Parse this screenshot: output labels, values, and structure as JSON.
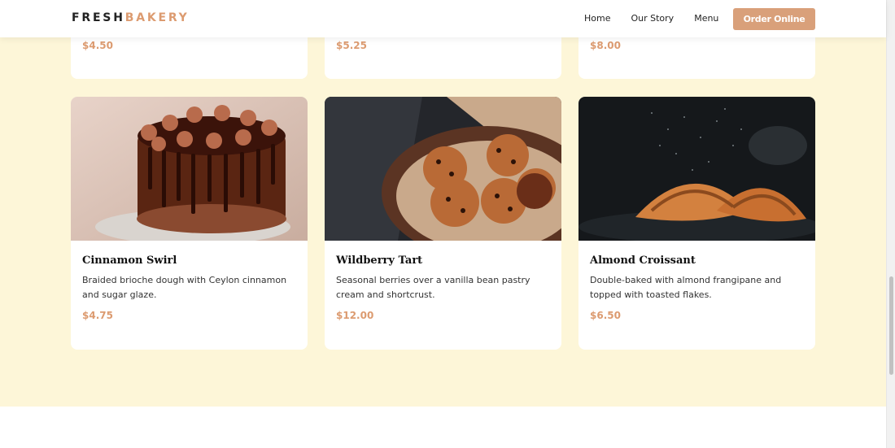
{
  "brand": {
    "part1": "FRESH",
    "part2": "BAKERY"
  },
  "nav": {
    "links": [
      "Home",
      "Our Story",
      "Menu"
    ],
    "cta": "Order Online"
  },
  "top_cards": [
    {
      "price": "$4.50"
    },
    {
      "price": "$5.25"
    },
    {
      "price": "$8.00"
    }
  ],
  "products": [
    {
      "title": "Cinnamon Swirl",
      "description": "Braided brioche dough with Ceylon cinnamon and sugar glaze.",
      "price": "$4.75",
      "image": "chocolate-cake-photo"
    },
    {
      "title": "Wildberry Tart",
      "description": "Seasonal berries over a vanilla bean pastry cream and shortcrust.",
      "price": "$12.00",
      "image": "cookies-basket-photo"
    },
    {
      "title": "Almond Croissant",
      "description": "Double-baked with almond frangipane and topped with toasted flakes.",
      "price": "$6.50",
      "image": "croissant-photo"
    }
  ],
  "colors": {
    "accent": "#dc9b70",
    "button": "#d9a07a",
    "section_bg": "#fdf6d8"
  }
}
